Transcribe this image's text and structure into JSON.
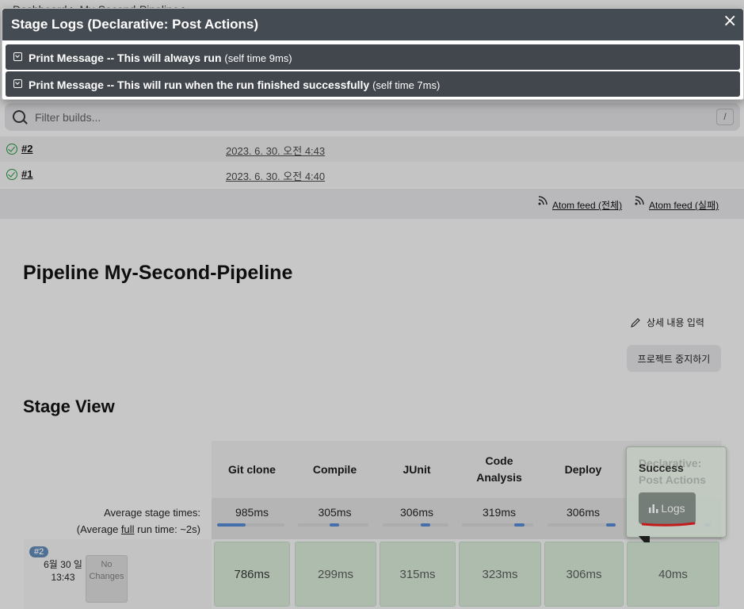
{
  "breadcrumb": "Dashboard > My-Second-Pipeline >",
  "modal": {
    "title": "Stage Logs (Declarative: Post Actions)",
    "close": "×",
    "rows": [
      {
        "label": "Print Message -- This will always run",
        "self_time": "(self time 9ms)"
      },
      {
        "label": "Print Message -- This will run when the run finished successfully",
        "self_time": "(self time 7ms)"
      }
    ]
  },
  "filter": {
    "placeholder": "Filter builds...",
    "shortcut": "/"
  },
  "builds": [
    {
      "number": "#2",
      "date": "2023. 6. 30. 오전 4:43",
      "status": "success"
    },
    {
      "number": "#1",
      "date": "2023. 6. 30. 오전 4:40",
      "status": "success"
    }
  ],
  "feeds": {
    "all": "Atom feed (전체)",
    "failed": "Atom feed (실패)"
  },
  "pipeline_title": "Pipeline My-Second-Pipeline",
  "actions": {
    "edit_description": "상세 내용 입력",
    "stop_project": "프로젝트 중지하기"
  },
  "stage_view": {
    "title": "Stage View",
    "avg_label_1": "Average stage times:",
    "avg_label_2_pre": "(Average ",
    "avg_label_2_link": "full",
    "avg_label_2_post": " run time: ~2s)",
    "stages": [
      {
        "name": "Git clone",
        "avg": "985ms",
        "run": "786ms"
      },
      {
        "name": "Compile",
        "avg": "305ms",
        "run": "299ms"
      },
      {
        "name": "JUnit",
        "avg": "306ms",
        "run": "315ms"
      },
      {
        "name": "Code Analysis",
        "avg": "319ms",
        "run": "323ms"
      },
      {
        "name": "Deploy",
        "avg": "306ms",
        "run": "306ms"
      },
      {
        "name": "Declarative: Post Actions",
        "avg": "",
        "run": "40ms"
      }
    ],
    "run": {
      "badge": "#2",
      "date": "6월 30 일",
      "time": "13:43",
      "changes": "No Changes"
    }
  },
  "popover": {
    "status": "Success",
    "logs_button": "Logs"
  },
  "colors": {
    "modal_header": "#454b52",
    "success_cell": "#c7d7c7",
    "progress": "#4f7fc3",
    "annotation": "#e02020"
  }
}
